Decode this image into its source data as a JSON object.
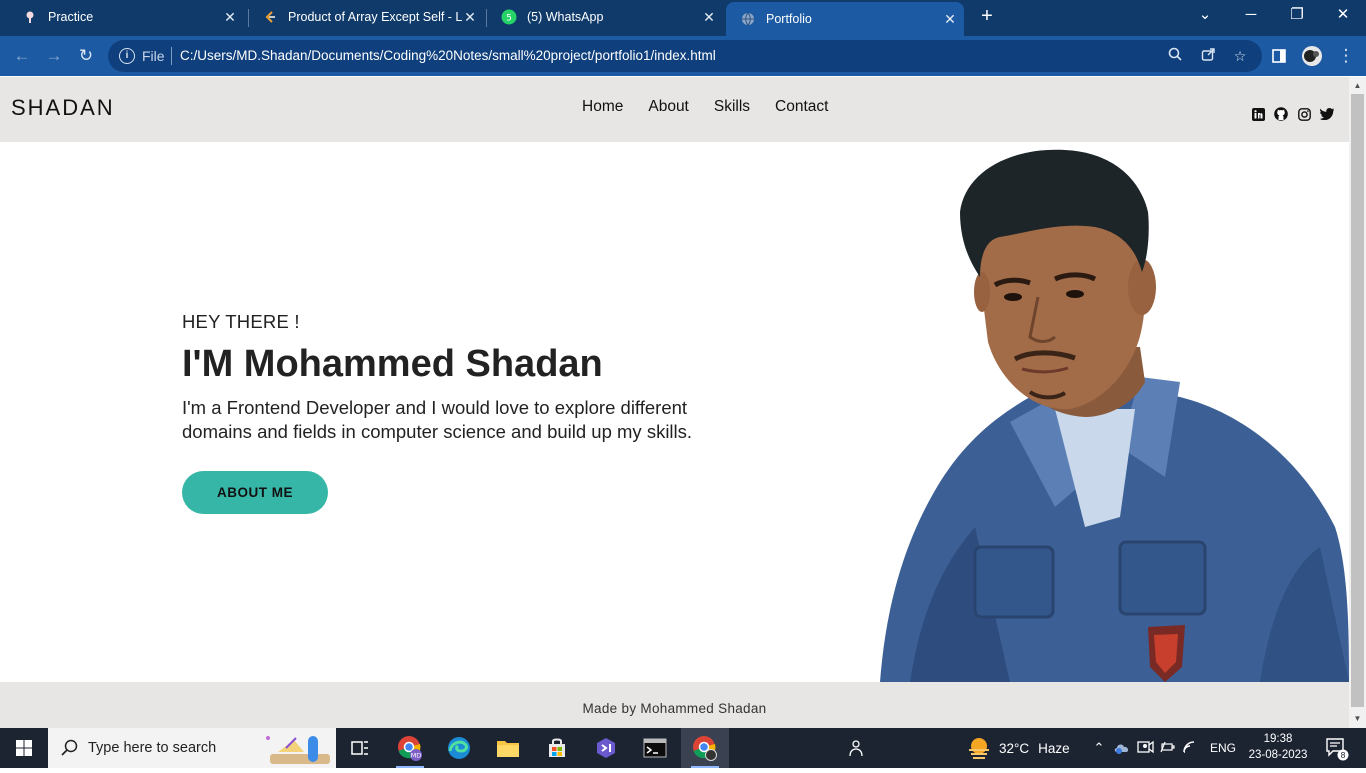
{
  "browser": {
    "tabs": [
      {
        "title": "Practice"
      },
      {
        "title": "Product of Array Except Self - LeetCode"
      },
      {
        "title": "(5) WhatsApp",
        "badge": "5"
      },
      {
        "title": "Portfolio",
        "active": true
      }
    ],
    "address": {
      "scheme_label": "File",
      "url": "C:/Users/MD.Shadan/Documents/Coding%20Notes/small%20project/portfolio1/index.html"
    }
  },
  "site": {
    "logo": "SHADAN",
    "nav": [
      "Home",
      "About",
      "Skills",
      "Contact"
    ],
    "socials": [
      "linkedin-icon",
      "github-icon",
      "instagram-icon",
      "twitter-icon"
    ],
    "hero": {
      "greeting": "HEY THERE !",
      "name": "I'M Mohammed Shadan",
      "description": "I'm a Frontend Developer and I would love to explore different domains and fields in computer science and build up my skills.",
      "button": "ABOUT ME",
      "accent": "#36b6a6"
    },
    "footer": "Made by Mohammed Shadan"
  },
  "taskbar": {
    "search_placeholder": "Type here to search",
    "weather": {
      "temp": "32°C",
      "condition": "Haze"
    },
    "language": "ENG",
    "time": "19:38",
    "date": "23-08-2023",
    "notifications": "8"
  }
}
